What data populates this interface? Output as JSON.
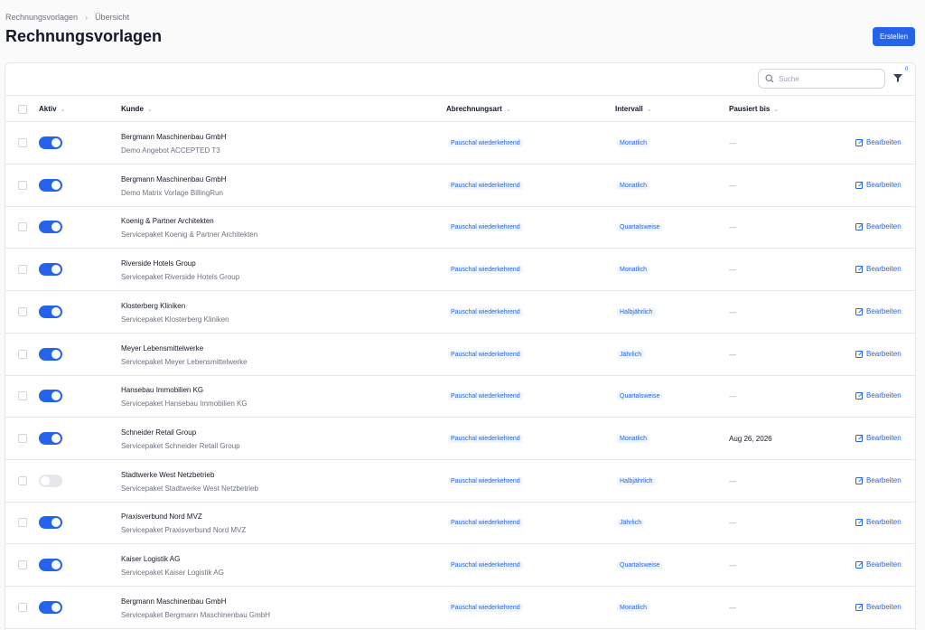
{
  "breadcrumb": {
    "items": [
      "Rechnungsvorlagen",
      "Übersicht"
    ]
  },
  "page": {
    "title": "Rechnungsvorlagen",
    "create_label": "Erstellen"
  },
  "toolbar": {
    "search_placeholder": "Suche",
    "filter_count": "0"
  },
  "table": {
    "headers": {
      "active": "Aktiv",
      "customer": "Kunde",
      "billing_type": "Abrechnungsart",
      "interval": "Intervall",
      "paused_until": "Pausiert bis"
    },
    "rows": [
      {
        "active": true,
        "customer": "Bergmann Maschinenbau GmbH",
        "template": "Demo Angebot ACCEPTED T3",
        "billing_type": "Pauschal wiederkehrend",
        "interval": "Monatlich",
        "paused_until": "—",
        "edit_label": "Bearbeiten"
      },
      {
        "active": true,
        "customer": "Bergmann Maschinenbau GmbH",
        "template": "Demo Matrix Vorlage BillingRun",
        "billing_type": "Pauschal wiederkehrend",
        "interval": "Monatlich",
        "paused_until": "—",
        "edit_label": "Bearbeiten"
      },
      {
        "active": true,
        "customer": "Koenig & Partner Architekten",
        "template": "Servicepaket Koenig & Partner Architekten",
        "billing_type": "Pauschal wiederkehrend",
        "interval": "Quartalsweise",
        "paused_until": "—",
        "edit_label": "Bearbeiten"
      },
      {
        "active": true,
        "customer": "Riverside Hotels Group",
        "template": "Servicepaket Riverside Hotels Group",
        "billing_type": "Pauschal wiederkehrend",
        "interval": "Monatlich",
        "paused_until": "—",
        "edit_label": "Bearbeiten"
      },
      {
        "active": true,
        "customer": "Klosterberg Kliniken",
        "template": "Servicepaket Klosterberg Kliniken",
        "billing_type": "Pauschal wiederkehrend",
        "interval": "Halbjährlich",
        "paused_until": "—",
        "edit_label": "Bearbeiten"
      },
      {
        "active": true,
        "customer": "Meyer Lebensmittelwerke",
        "template": "Servicepaket Meyer Lebensmittelwerke",
        "billing_type": "Pauschal wiederkehrend",
        "interval": "Jährlich",
        "paused_until": "—",
        "edit_label": "Bearbeiten"
      },
      {
        "active": true,
        "customer": "Hansebau Immobilien KG",
        "template": "Servicepaket Hansebau Immobilien KG",
        "billing_type": "Pauschal wiederkehrend",
        "interval": "Quartalsweise",
        "paused_until": "—",
        "edit_label": "Bearbeiten"
      },
      {
        "active": true,
        "customer": "Schneider Retail Group",
        "template": "Servicepaket Schneider Retail Group",
        "billing_type": "Pauschal wiederkehrend",
        "interval": "Monatlich",
        "paused_until": "Aug 26, 2026",
        "edit_label": "Bearbeiten"
      },
      {
        "active": false,
        "customer": "Stadtwerke West Netzbetrieb",
        "template": "Servicepaket Stadtwerke West Netzbetrieb",
        "billing_type": "Pauschal wiederkehrend",
        "interval": "Halbjährlich",
        "paused_until": "—",
        "edit_label": "Bearbeiten"
      },
      {
        "active": true,
        "customer": "Praxisverbund Nord MVZ",
        "template": "Servicepaket Praxisverbund Nord MVZ",
        "billing_type": "Pauschal wiederkehrend",
        "interval": "Jährlich",
        "paused_until": "—",
        "edit_label": "Bearbeiten"
      },
      {
        "active": true,
        "customer": "Kaiser Logistik AG",
        "template": "Servicepaket Kaiser Logistik AG",
        "billing_type": "Pauschal wiederkehrend",
        "interval": "Quartalsweise",
        "paused_until": "—",
        "edit_label": "Bearbeiten"
      },
      {
        "active": true,
        "customer": "Bergmann Maschinenbau GmbH",
        "template": "Servicepaket Bergmann Maschinenbau GmbH",
        "billing_type": "Pauschal wiederkehrend",
        "interval": "Monatlich",
        "paused_until": "—",
        "edit_label": "Bearbeiten"
      }
    ]
  }
}
